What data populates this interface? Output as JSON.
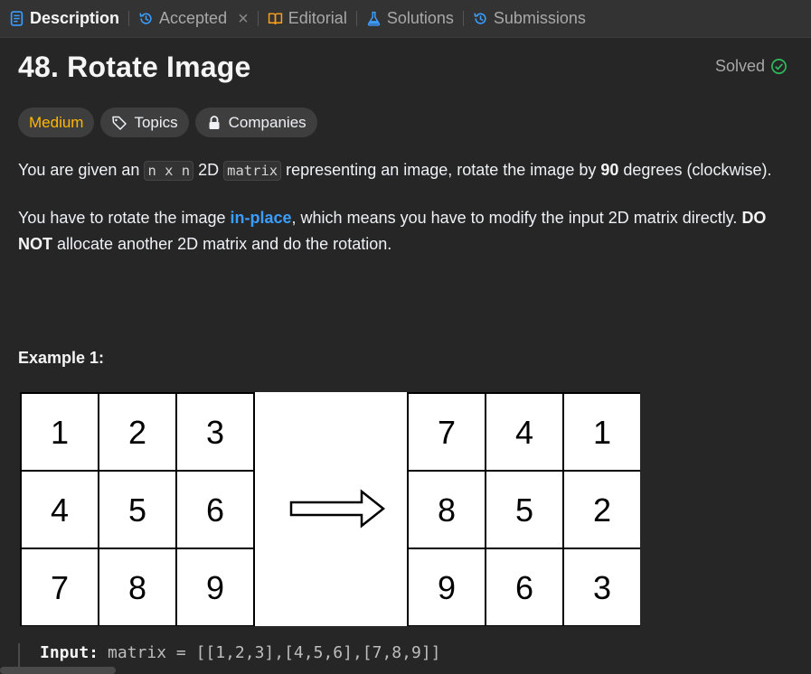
{
  "tabs": [
    {
      "label": "Description",
      "icon": "description-icon",
      "active": true
    },
    {
      "label": "Accepted",
      "icon": "history-icon"
    },
    {
      "label": "Editorial",
      "icon": "book-icon"
    },
    {
      "label": "Solutions",
      "icon": "flask-icon"
    },
    {
      "label": "Submissions",
      "icon": "history-icon"
    }
  ],
  "problem": {
    "title": "48. Rotate Image",
    "status": "Solved",
    "difficulty": "Medium",
    "topics_label": "Topics",
    "companies_label": "Companies"
  },
  "description": {
    "p1_a": "You are given an ",
    "p1_code1": "n x n",
    "p1_b": " 2D ",
    "p1_code2": "matrix",
    "p1_c": " representing an image, rotate the image by ",
    "p1_bold": "90",
    "p1_d": " degrees (clockwise).",
    "p2_a": "You have to rotate the image ",
    "p2_link": "in-place",
    "p2_b": ", which means you have to modify the input 2D matrix directly. ",
    "p2_bold": "DO NOT",
    "p2_c": " allocate another 2D matrix and do the rotation."
  },
  "example": {
    "title": "Example 1:",
    "input_matrix": [
      [
        "1",
        "2",
        "3"
      ],
      [
        "4",
        "5",
        "6"
      ],
      [
        "7",
        "8",
        "9"
      ]
    ],
    "output_matrix": [
      [
        "7",
        "4",
        "1"
      ],
      [
        "8",
        "5",
        "2"
      ],
      [
        "9",
        "6",
        "3"
      ]
    ],
    "input_label": "Input:",
    "input_text": "matrix = [[1,2,3],[4,5,6],[7,8,9]]"
  },
  "colors": {
    "background": "#262626",
    "tabbar": "#333333",
    "medium": "#ffb800",
    "link": "#3b9dff",
    "solved_check": "#2cbb5d"
  }
}
